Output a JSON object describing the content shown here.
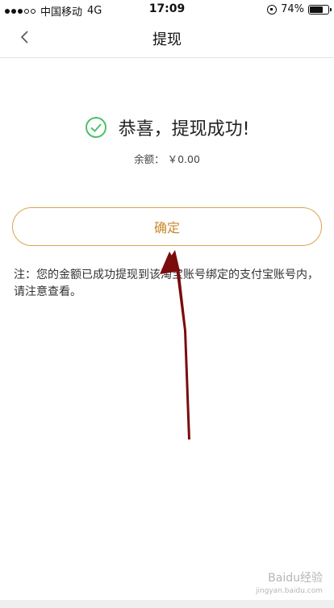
{
  "status_bar": {
    "carrier": "中国移动",
    "network": "4G",
    "time": "17:09",
    "battery": "74%",
    "battery_level": 0.74
  },
  "nav": {
    "title": "提现",
    "back_icon": "chevron-left-icon"
  },
  "success": {
    "icon": "check-circle-icon",
    "message": "恭喜，提现成功!",
    "color": "#4cc06a"
  },
  "balance": {
    "label": "余额：",
    "value": "￥0.00"
  },
  "confirm_button": {
    "label": "确定",
    "color": "#d9a44d"
  },
  "note": {
    "text": "注：您的金额已成功提现到该淘宝账号绑定的支付宝账号内，请注意查看。"
  },
  "watermark": {
    "brand": "Baidu经验",
    "url": "jingyan.baidu.com"
  }
}
